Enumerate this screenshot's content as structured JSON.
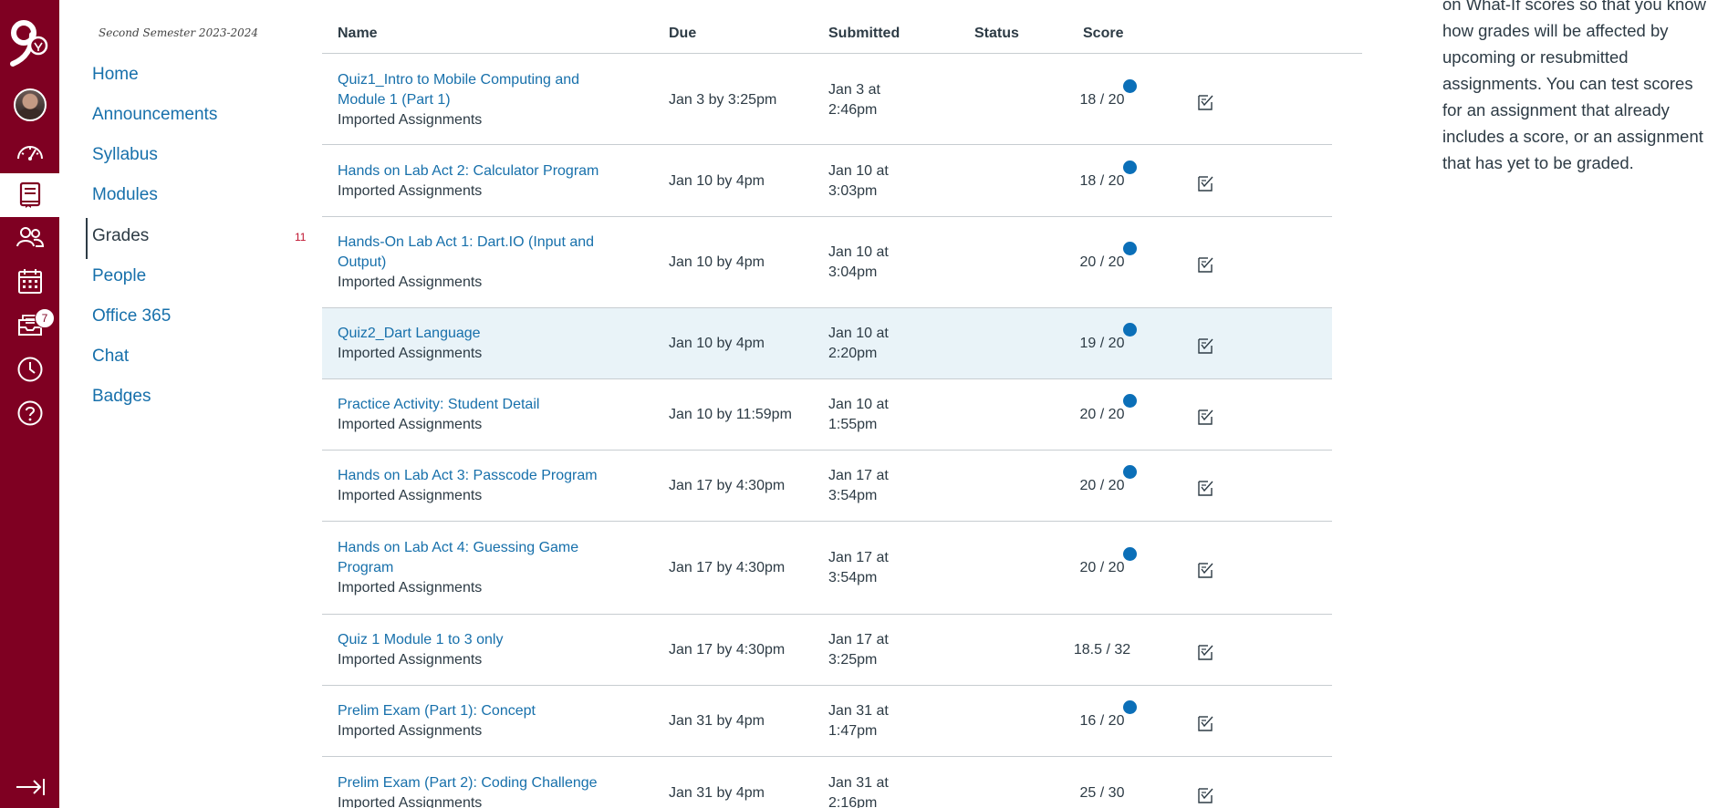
{
  "global_nav": {
    "logo": "school-logo",
    "inbox_count": "7",
    "items": [
      {
        "name": "account",
        "icon": "avatar"
      },
      {
        "name": "dashboard",
        "icon": "dashboard-icon"
      },
      {
        "name": "courses",
        "icon": "courses-icon"
      },
      {
        "name": "groups",
        "icon": "groups-icon"
      },
      {
        "name": "calendar",
        "icon": "calendar-icon"
      },
      {
        "name": "inbox",
        "icon": "inbox-icon"
      },
      {
        "name": "history",
        "icon": "clock-icon"
      },
      {
        "name": "help",
        "icon": "help-icon"
      }
    ],
    "collapse_icon": "collapse-nav-icon",
    "bg_color": "#7f0022"
  },
  "course_nav": {
    "term": "Second Semester 2023-2024",
    "items": [
      "Home",
      "Announcements",
      "Syllabus",
      "Modules",
      "Grades",
      "People",
      "Office 365",
      "Chat",
      "Badges"
    ],
    "active": "Grades",
    "grades_count": "11"
  },
  "table": {
    "headers": {
      "name": "Name",
      "due": "Due",
      "submitted": "Submitted",
      "status": "Status",
      "score": "Score"
    },
    "rows": [
      {
        "title": "Quiz1_Intro to Mobile Computing and Module 1 (Part 1)",
        "group": "Imported Assignments",
        "due": "Jan 3 by 3:25pm",
        "submitted": "Jan 3 at 2:46pm",
        "score": "18 / 20",
        "unread": true
      },
      {
        "title": "Hands on Lab Act 2: Calculator Program",
        "group": "Imported Assignments",
        "due": "Jan 10 by 4pm",
        "submitted": "Jan 10 at 3:03pm",
        "score": "18 / 20",
        "unread": true
      },
      {
        "title": "Hands-On Lab Act 1: Dart.IO (Input and Output)",
        "group": "Imported Assignments",
        "due": "Jan 10 by 4pm",
        "submitted": "Jan 10 at 3:04pm",
        "score": "20 / 20",
        "unread": true
      },
      {
        "title": "Quiz2_Dart Language",
        "group": "Imported Assignments",
        "due": "Jan 10 by 4pm",
        "submitted": "Jan 10 at 2:20pm",
        "score": "19 / 20",
        "unread": true
      },
      {
        "title": "Practice Activity: Student Detail",
        "group": "Imported Assignments",
        "due": "Jan 10 by 11:59pm",
        "submitted": "Jan 10 at 1:55pm",
        "score": "20 / 20",
        "unread": true
      },
      {
        "title": "Hands on Lab Act 3: Passcode Program",
        "group": "Imported Assignments",
        "due": "Jan 17 by 4:30pm",
        "submitted": "Jan 17 at 3:54pm",
        "score": "20 / 20",
        "unread": true
      },
      {
        "title": "Hands on Lab Act 4: Guessing Game Program",
        "group": "Imported Assignments",
        "due": "Jan 17 by 4:30pm",
        "submitted": "Jan 17 at 3:54pm",
        "score": "20 / 20",
        "unread": true
      },
      {
        "title": "Quiz 1 Module 1 to 3 only",
        "group": "Imported Assignments",
        "due": "Jan 17 by 4:30pm",
        "submitted": "Jan 17 at 3:25pm",
        "score": "18.5 / 32",
        "unread": false
      },
      {
        "title": "Prelim Exam (Part 1): Concept",
        "group": "Imported Assignments",
        "due": "Jan 31 by 4pm",
        "submitted": "Jan 31 at 1:47pm",
        "score": "16 / 20",
        "unread": true
      },
      {
        "title": "Prelim Exam (Part 2): Coding Challenge",
        "group": "Imported Assignments",
        "due": "Jan 31 by 4pm",
        "submitted": "Jan 31 at 2:16pm",
        "score": "25 / 30",
        "unread": false
      }
    ],
    "highlighted_row": 3
  },
  "sidebar": {
    "text": "on What-If scores so that you know how grades will be affected by upcoming or resubmitted assignments. You can test scores for an assignment that already includes a score, or an assignment that has yet to be graded."
  },
  "colors": {
    "link": "#1770ab",
    "text": "#2d3b45",
    "unread_dot": "#0b6fb8",
    "highlight": "#e9f3f8"
  }
}
